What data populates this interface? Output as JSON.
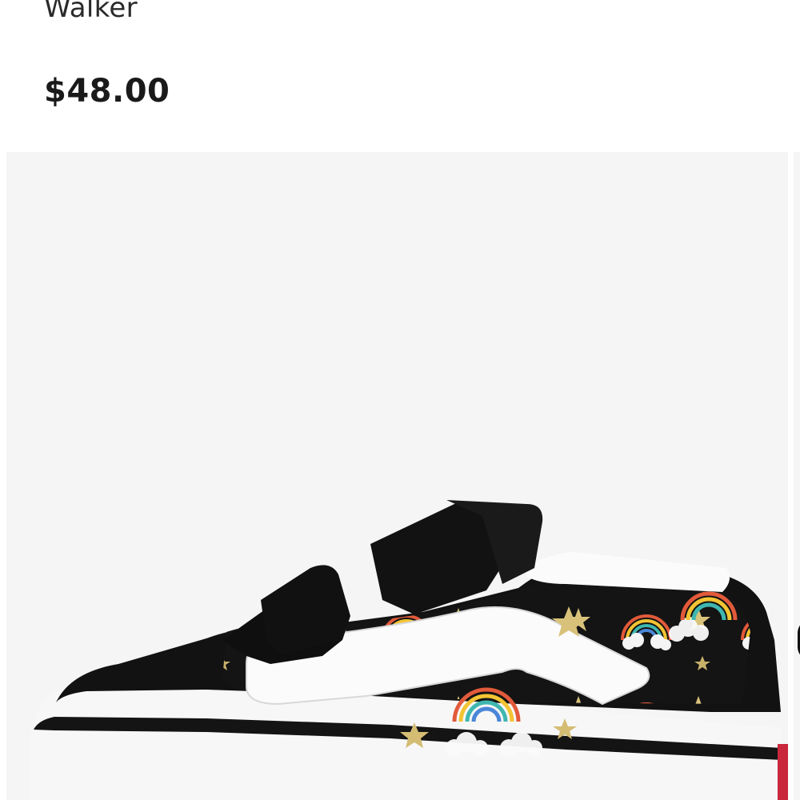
{
  "product": {
    "title_fragment": "Walker",
    "price": "$48.00"
  },
  "gallery": {
    "image_subject": "sneaker-photo",
    "background_color": "#f5f5f5"
  },
  "colors": {
    "text": "#1a1a1a",
    "shoe_black": "#121212",
    "sole_white": "#f7f7f7",
    "stripe_red": "#c8283a"
  }
}
